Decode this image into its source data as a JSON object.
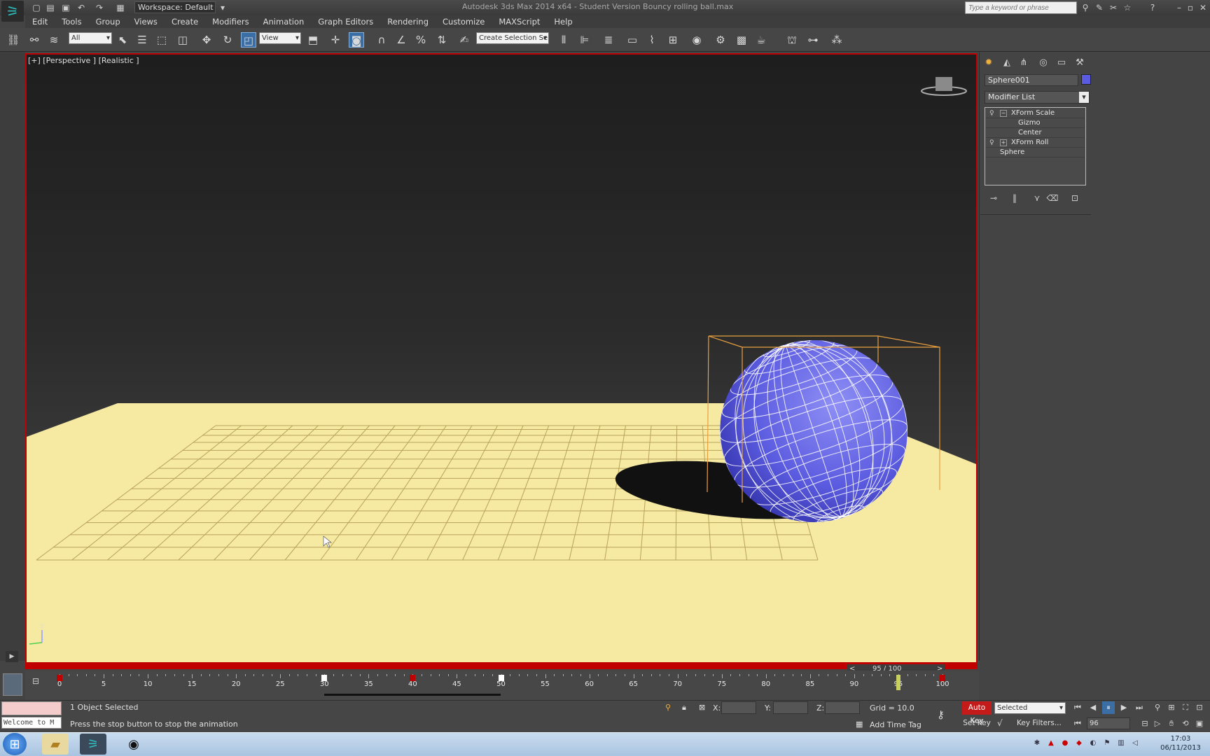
{
  "titlebar": {
    "workspace": "Workspace: Default",
    "title": "Autodesk 3ds Max 2014 x64 - Student Version   Bouncy rolling ball.max",
    "search_placeholder": "Type a keyword or phrase"
  },
  "menu": [
    "Edit",
    "Tools",
    "Group",
    "Views",
    "Create",
    "Modifiers",
    "Animation",
    "Graph Editors",
    "Rendering",
    "Customize",
    "MAXScript",
    "Help"
  ],
  "toolbar": {
    "filter": "All",
    "ref_coord": "View",
    "selection_set": "Create Selection Se"
  },
  "viewport": {
    "label": "[+] [Perspective ] [Realistic ]",
    "axis_z": "z",
    "axis_x": "x"
  },
  "command_panel": {
    "object_name": "Sphere001",
    "object_color": "#5b5be0",
    "modifier_list": "Modifier List",
    "stack": [
      {
        "label": "XForm Scale",
        "level": 0
      },
      {
        "label": "Gizmo",
        "level": 1
      },
      {
        "label": "Center",
        "level": 1
      },
      {
        "label": "XForm Roll",
        "level": 0
      },
      {
        "label": "Sphere",
        "level": 0
      }
    ]
  },
  "timeline": {
    "frame_display": "95 / 100",
    "current_frame": 95,
    "total_frames": 100,
    "ticks": [
      0,
      5,
      10,
      15,
      20,
      25,
      30,
      35,
      40,
      45,
      50,
      55,
      60,
      65,
      70,
      75,
      80,
      85,
      90,
      95,
      100
    ]
  },
  "status": {
    "listener_text": "Welcome to M",
    "selected": "1 Object Selected",
    "prompt": "Press the stop button to stop the animation",
    "x_label": "X:",
    "y_label": "Y:",
    "z_label": "Z:",
    "grid": "Grid = 10.0",
    "add_time_tag": "Add Time Tag",
    "auto_key": "Auto Key",
    "set_key": "Set Key",
    "selected_dropdown": "Selected",
    "key_filters": "Key Filters...",
    "frame_field": "96"
  },
  "taskbar": {
    "time": "17:03",
    "date": "06/11/2013"
  },
  "colors": {
    "viewport_border": "#c00000",
    "ground": "#f6e9a2",
    "ball": "#5b5be0",
    "auto_key": "#c41a1a"
  }
}
